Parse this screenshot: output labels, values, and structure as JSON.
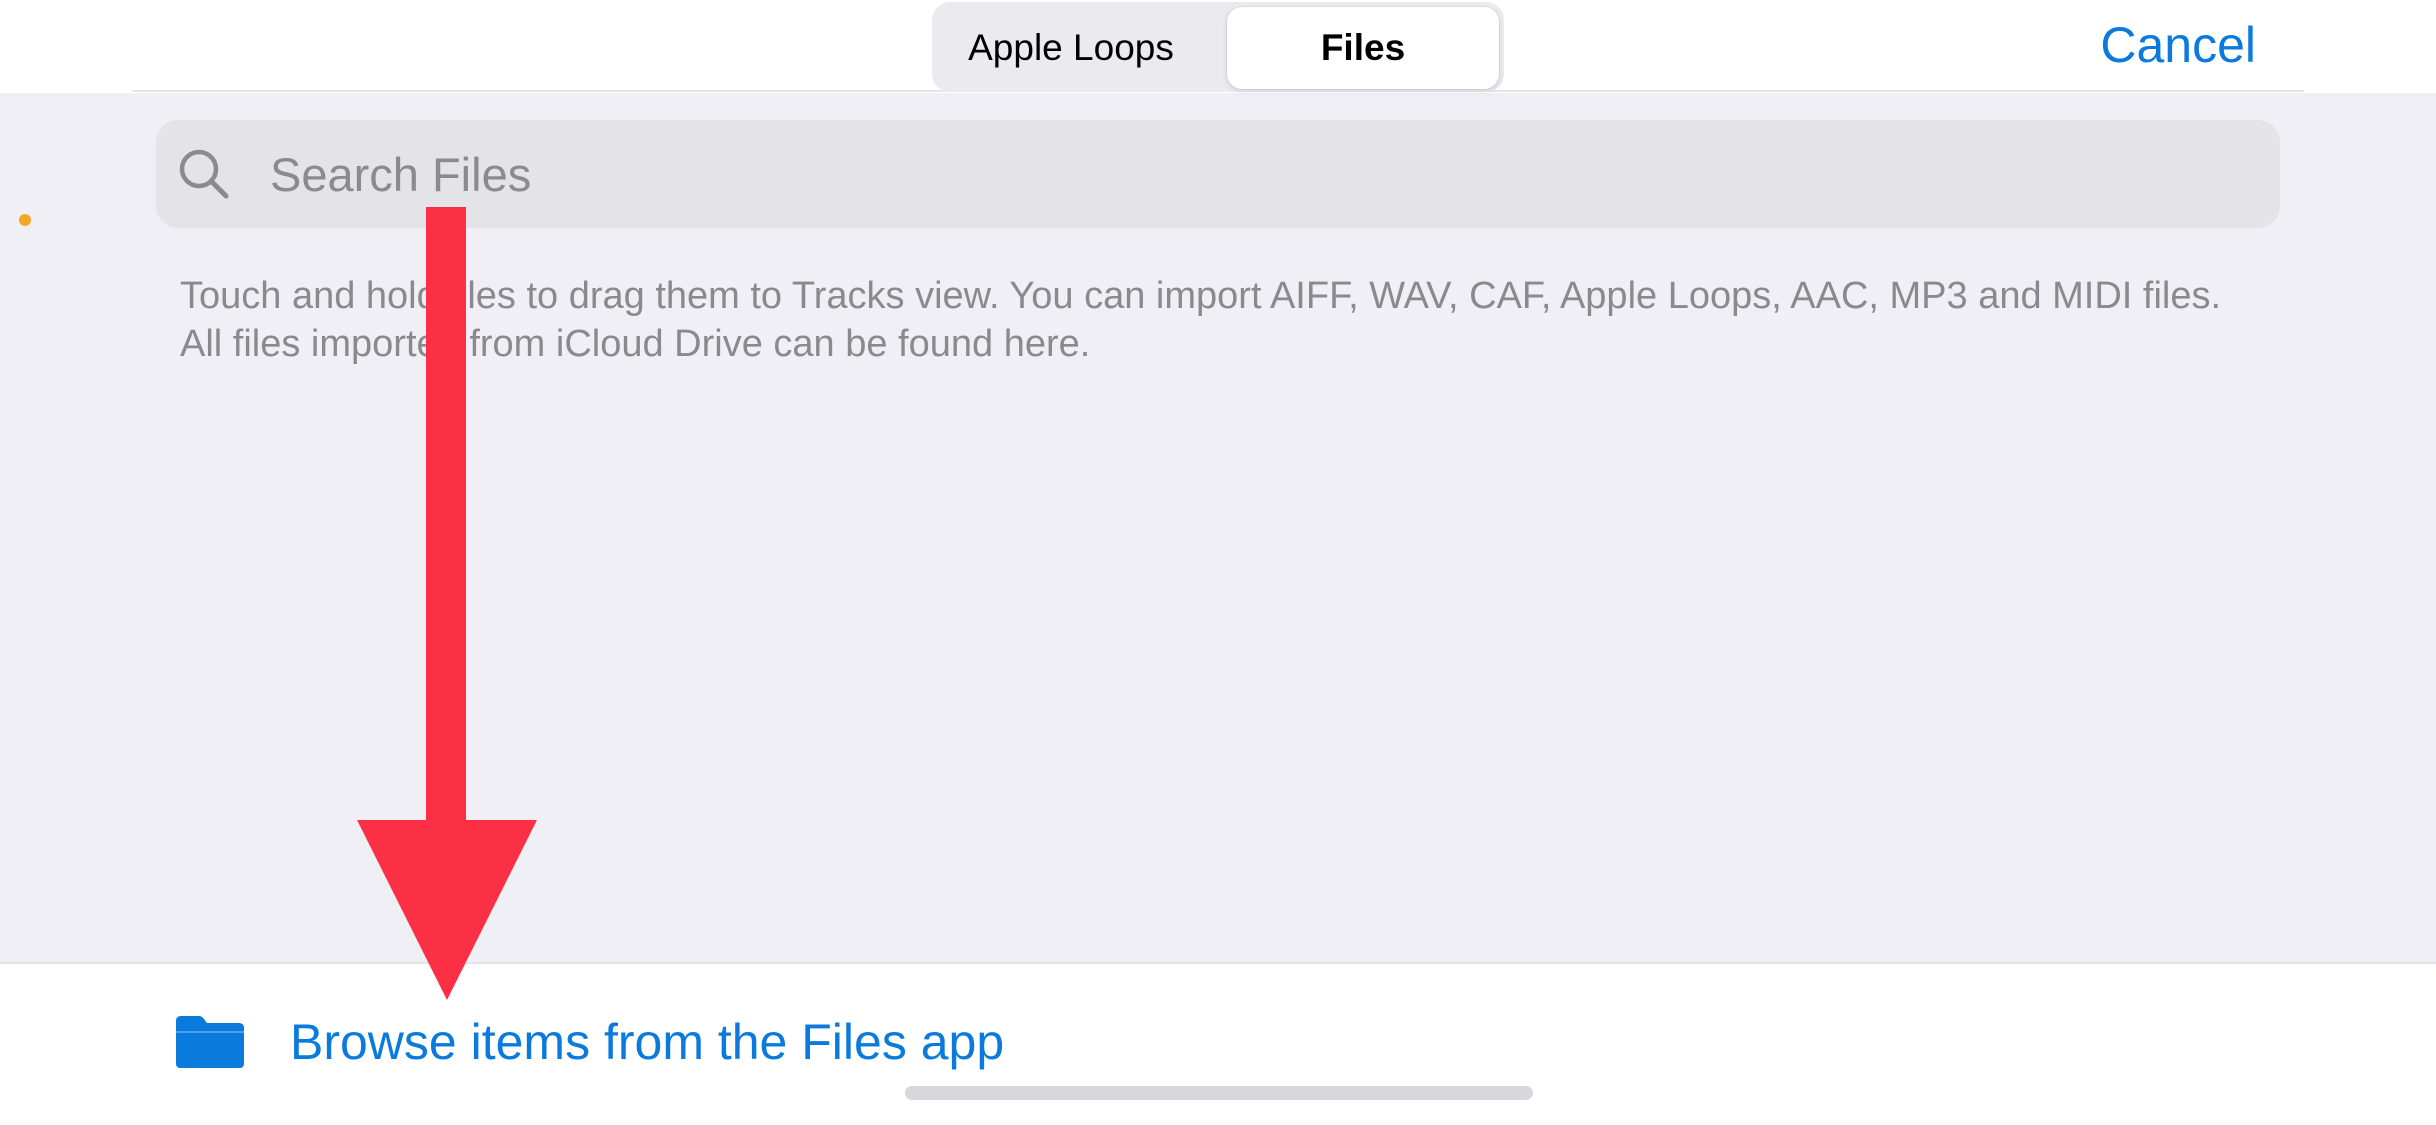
{
  "header": {
    "segments": [
      {
        "label": "Apple Loops",
        "selected": false
      },
      {
        "label": "Files",
        "selected": true
      }
    ],
    "cancel_label": "Cancel"
  },
  "search": {
    "placeholder": "Search Files",
    "value": "",
    "icon": "magnifying-glass-icon"
  },
  "info_text": "Touch and hold files to drag them to Tracks view. You can import AIFF, WAV, CAF, Apple Loops, AAC, MP3 and MIDI files. All files imported from iCloud Drive can be found here.",
  "bottom": {
    "browse_label": "Browse items from the Files app",
    "icon": "folder-icon"
  },
  "annotation": {
    "type": "arrow",
    "direction": "down",
    "color": "#fc3044"
  },
  "colors": {
    "accent": "#0a7bdc",
    "background": "#f0eff5",
    "status_dot": "#f5a623"
  }
}
